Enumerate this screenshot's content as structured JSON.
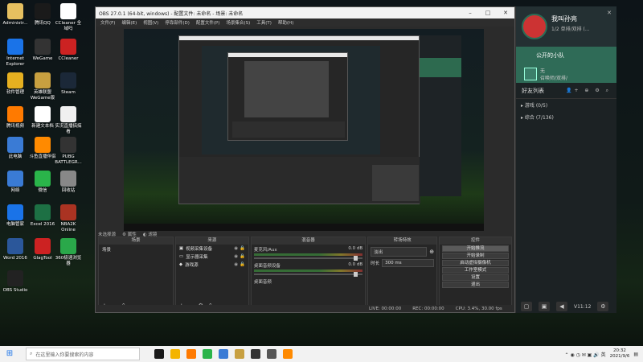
{
  "desktop": {
    "icons": [
      {
        "label": "Administr...",
        "color": "#e6c060"
      },
      {
        "label": "腾讯QQ",
        "color": "#1a1a1a"
      },
      {
        "label": "CCleaner 全域吗",
        "color": "#ffffff"
      },
      {
        "label": "Internet Explorer",
        "color": "#1a73e8"
      },
      {
        "label": "WeGame",
        "color": "#333333"
      },
      {
        "label": "CCleaner",
        "color": "#cc2222"
      },
      {
        "label": "软件管理",
        "color": "#e6b020"
      },
      {
        "label": "英雄联盟WeGame版",
        "color": "#c8a040"
      },
      {
        "label": "Steam",
        "color": "#1b2838"
      },
      {
        "label": "腾讯视频",
        "color": "#ff7a00"
      },
      {
        "label": "新建文本档",
        "color": "#ffffff"
      },
      {
        "label": "实况直播搞搞看",
        "color": "#f0f0f0"
      },
      {
        "label": "此电脑",
        "color": "#3a7bd5"
      },
      {
        "label": "斗鱼直播伴侣",
        "color": "#ff8a00"
      },
      {
        "label": "PUBG BATTLEGR...",
        "color": "#333333"
      },
      {
        "label": "网络",
        "color": "#3a7bd5"
      },
      {
        "label": "微信",
        "color": "#2ab44a"
      },
      {
        "label": "回收站",
        "color": "#888888"
      },
      {
        "label": "电脑管家",
        "color": "#1a73e8"
      },
      {
        "label": "Excel 2016",
        "color": "#1d7044"
      },
      {
        "label": "NBA2K Online",
        "color": "#aa3322"
      },
      {
        "label": "Word 2016",
        "color": "#2b579a"
      },
      {
        "label": "GlagTool",
        "color": "#cc2222"
      },
      {
        "label": "360极速浏览器",
        "color": "#2aa84a"
      },
      {
        "label": "OBS Studio",
        "color": "#222222"
      }
    ]
  },
  "obs": {
    "title": "OBS 27.0.1 (64-bit, windows) - 配置文件: 未命名 - 场景: 未命名",
    "window_controls": [
      "–",
      "□",
      "✕"
    ],
    "menu": [
      "文件(F)",
      "编辑(E)",
      "视图(V)",
      "停靠部件(D)",
      "配置文件(P)",
      "场景集合(S)",
      "工具(T)",
      "帮助(H)"
    ],
    "scene_bar": {
      "label": "未选择源",
      "properties": "属性",
      "filters": "滤镜"
    },
    "docks": {
      "scenes": {
        "title": "场景",
        "items": [
          "场景"
        ]
      },
      "sources": {
        "title": "来源",
        "items": [
          {
            "name": "视频采集设备",
            "icon": "camera-icon"
          },
          {
            "name": "显示器采集",
            "icon": "monitor-icon"
          },
          {
            "name": "游戏源",
            "icon": "game-icon"
          }
        ]
      },
      "mixer": {
        "title": "混音器",
        "tracks": [
          {
            "name": "麦克风/Aux",
            "db": "0.0 dB"
          },
          {
            "name": "桌面音频设备",
            "db": "0.0 dB"
          },
          {
            "name": "桌面音频",
            "db": ""
          }
        ]
      },
      "transitions": {
        "title": "转场特效",
        "type": "淡出",
        "duration_label": "时长",
        "duration_value": "300 ms"
      },
      "controls": {
        "title": "控件",
        "buttons": [
          "开始推流",
          "开始录制",
          "启动虚拟摄像机",
          "工作室模式",
          "设置",
          "退出"
        ]
      }
    },
    "status": {
      "live": "LIVE: 00:00:00",
      "rec": "REC: 00:00:00",
      "cpu": "CPU: 3.4%, 30.00 fps"
    }
  },
  "qq": {
    "name": "我叫孙亮",
    "status": "1/2 单排/双排 (...",
    "team_title": "公开的小队",
    "team_line1": "无",
    "team_line2": "召唤师/双排/",
    "friends_label": "好友列表",
    "groups": [
      "▸ 游戏 (0/5)",
      "▸ 综合 (7/136)"
    ],
    "bottom_time": "V11:12"
  },
  "taskbar": {
    "search_placeholder": "在这里输入你要搜索的内容",
    "time": "20:32",
    "date": "2021/9/6"
  }
}
